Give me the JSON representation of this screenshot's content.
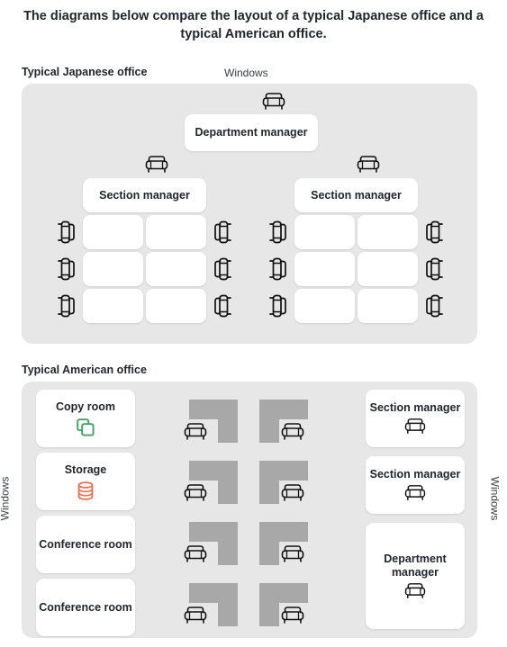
{
  "heading": "The diagrams below compare the layout of a typical Japanese office and a typical American office.",
  "japanese": {
    "caption": "Typical Japanese office",
    "windows_top_label": "Windows",
    "department_manager": "Department manager",
    "section_manager_left": "Section manager",
    "section_manager_right": "Section manager",
    "desk_rows": 3,
    "desk_cols_per_cluster": 2,
    "clusters": 2,
    "chair_icon": "sofa-icon",
    "side_chair_icon": "sofa-side-icon"
  },
  "american": {
    "caption": "Typical American office",
    "windows_left_label": "Windows",
    "windows_right_label": "Windows",
    "left_rooms": [
      {
        "label": "Copy room",
        "icon": "copy-icon",
        "color": "#3fa264"
      },
      {
        "label": "Storage",
        "icon": "database-icon",
        "color": "#f26c4c"
      },
      {
        "label": "Conference room",
        "icon": null,
        "color": null
      },
      {
        "label": "Conference room",
        "icon": null,
        "color": null
      }
    ],
    "right_rooms": [
      {
        "label": "Section manager",
        "icon": "sofa-icon"
      },
      {
        "label": "Section manager",
        "icon": "sofa-icon"
      },
      {
        "label": "Department manager",
        "icon": "sofa-icon"
      }
    ],
    "cubicle_rows": 4,
    "cubicle_cols": 2,
    "cubicle_color": "#a8a8a8",
    "cubicle_chair_icon": "sofa-icon"
  },
  "colors": {
    "panel_background": "#e7e7e7",
    "box_background": "#ffffff",
    "text": "#21272d",
    "desk_gray": "#a8a8a8",
    "copy_green": "#3fa264",
    "storage_orange": "#f26c4c"
  }
}
